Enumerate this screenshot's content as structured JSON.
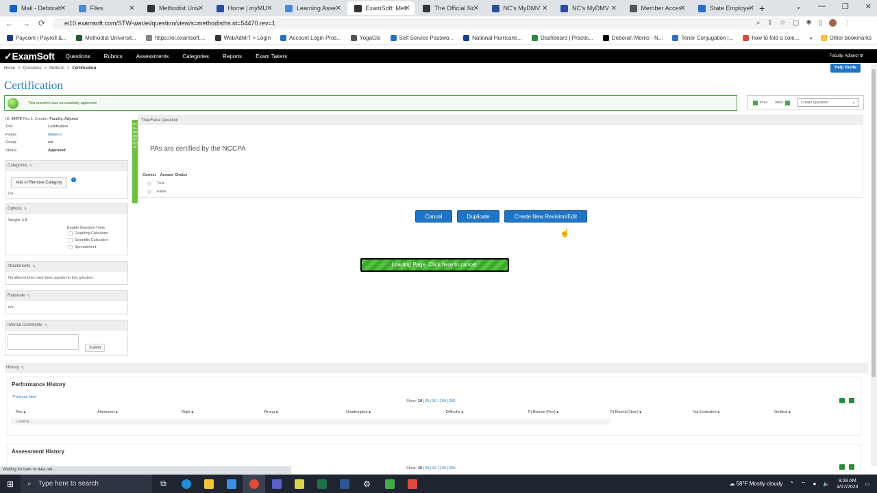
{
  "browser": {
    "tabs": [
      {
        "label": "Mail - Deborah",
        "color": "#0a64c9"
      },
      {
        "label": "Files",
        "color": "#4b8bd6"
      },
      {
        "label": "Methodist Unive",
        "color": "#333333"
      },
      {
        "label": "Home | myMU",
        "color": "#2a4da0"
      },
      {
        "label": "Learning Assess",
        "color": "#4b8bd6"
      },
      {
        "label": "ExamSoft: Meth",
        "color": "#333333"
      },
      {
        "label": "The Official Nor",
        "color": "#333333"
      },
      {
        "label": "NC's MyDMV",
        "color": "#2a4da0"
      },
      {
        "label": "NC's MyDMV",
        "color": "#2a4da0"
      },
      {
        "label": "Member Access",
        "color": "#555555"
      },
      {
        "label": "State Employee",
        "color": "#2a6dc7"
      }
    ],
    "url": "ei10.examsoft.com/STW-war/ei/question/view/s=methodisths.id=54470.rev=1",
    "bookmarks": [
      {
        "label": "Paycom | Payroll &...",
        "color": "#1a3c8c"
      },
      {
        "label": "Methodist Universit...",
        "color": "#1d5f2e"
      },
      {
        "label": "https://ei.examsoft....",
        "color": "#888888"
      },
      {
        "label": "WebAdMIT > Login",
        "color": "#333333"
      },
      {
        "label": "Account Login Pros...",
        "color": "#2a6dc7"
      },
      {
        "label": "YogaGlo",
        "color": "#555555"
      },
      {
        "label": "Self Service Passwo...",
        "color": "#2a6dc7"
      },
      {
        "label": "National Hurricane...",
        "color": "#1a3c8c"
      },
      {
        "label": "Dashboard | Practic...",
        "color": "#2a8d3e"
      },
      {
        "label": "Deborah Morris - N...",
        "color": "#000000"
      },
      {
        "label": "Tener Conjugation |...",
        "color": "#2a6dc7"
      },
      {
        "label": "how to fold a cole...",
        "color": "#dd4b39"
      }
    ],
    "other_bookmarks": "Other bookmarks",
    "status_text": "Waiting for bam.nr-data.net..."
  },
  "app": {
    "logo": "ExamSoft",
    "nav": [
      "Questions",
      "Rubrics",
      "Assessments",
      "Categories",
      "Reports",
      "Exam Takers"
    ],
    "user": "Faculty, Adjunct",
    "help": "Help Guide",
    "breadcrumb": [
      "Home",
      "Questions",
      "Midterm",
      "Certification"
    ],
    "page_title": "Certification",
    "success_msg": "This question was successfully approved",
    "pager": {
      "prev": "Prev",
      "next": "Next",
      "select": "Create Question"
    },
    "meta": {
      "id_line": {
        "id_label": "ID:",
        "id": "54470",
        "rest": "Rev 1, Creator:",
        "creator": "Faculty, Adjunct"
      },
      "rows": [
        {
          "k": "Title:",
          "v": "Certification"
        },
        {
          "k": "Folder:",
          "v": "Midterm"
        },
        {
          "k": "Group:",
          "v": "n/a"
        },
        {
          "k": "Status:",
          "v": "Approved"
        }
      ]
    },
    "categories": {
      "title": "Categories",
      "button": "Add or Remove Category",
      "value": "n/a"
    },
    "options": {
      "title": "Options",
      "weight_label": "Weight:",
      "weight": "1.0",
      "tools_label": "Enable Question Tools:",
      "tools": [
        "Graphing Calculator",
        "Scientific Calculator",
        "Spreadsheet"
      ]
    },
    "attachments": {
      "title": "Attachments",
      "text": "No attachments have been applied to this question."
    },
    "rationale": {
      "title": "Rationale",
      "value": "n/a"
    },
    "comments": {
      "title": "Internal Comments",
      "submit": "Submit"
    },
    "expand_label": "EXPAND QUESTION",
    "question": {
      "type": "True/False Question",
      "text": "PAs are certified by the NCCPA",
      "col_correct": "Correct",
      "col_answer": "Answer Choice",
      "answers": [
        "True",
        "False"
      ]
    },
    "actions": {
      "cancel": "Cancel",
      "duplicate": "Duplicate",
      "revise": "Create New Revision/Edit"
    },
    "loading": "Loading Page. Click here to cancel.",
    "history": {
      "title": "History",
      "performance": {
        "title": "Performance History",
        "prev": "Previous",
        "next": "Next",
        "show_label": "Show:",
        "show_current": "10",
        "show_options": [
          "25",
          "50",
          "100",
          "250"
        ],
        "columns": [
          "Rev",
          "Attempted",
          "Right",
          "Wrong",
          "Unattempted",
          "Difficulty",
          "Pt Biserial (Rev)",
          "Pt Biserial (Item)",
          "Not Evaluated",
          "Omitted"
        ],
        "loading": "Loading..."
      },
      "assessment": {
        "title": "Assessment History",
        "show_label": "Show:",
        "show_current": "10",
        "show_options": [
          "25",
          "50",
          "100",
          "250"
        ]
      }
    }
  },
  "taskbar": {
    "search_placeholder": "Type here to search",
    "weather": "58°F  Mostly cloudy",
    "time": "9:28 AM",
    "date": "4/17/2023"
  }
}
